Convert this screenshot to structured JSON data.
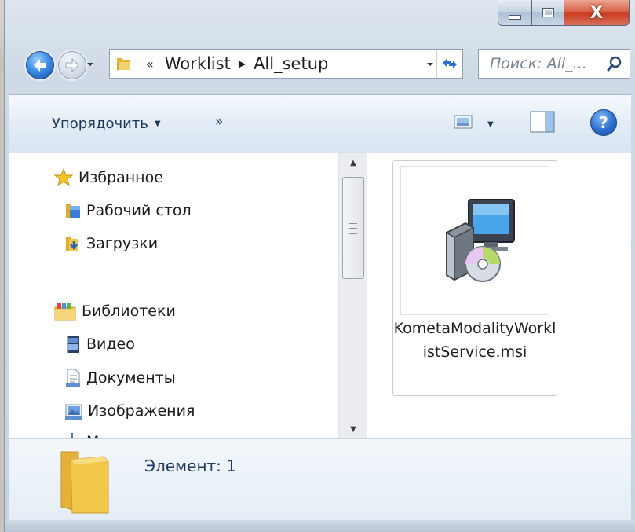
{
  "window": {
    "caption_buttons": {
      "minimize": "minimize",
      "maximize": "maximize",
      "close": "X"
    }
  },
  "navigation": {
    "back": "back",
    "forward": "forward"
  },
  "address_bar": {
    "overflow": "«",
    "crumbs": [
      "Worklist",
      "All_setup"
    ]
  },
  "search": {
    "placeholder": "Поиск: All_..."
  },
  "toolbar": {
    "organize_label": "Упорядочить",
    "more_label": "»",
    "help_label": "?"
  },
  "nav_pane": {
    "favorites": {
      "label": "Избранное",
      "items": [
        "Рабочий стол",
        "Загрузки"
      ]
    },
    "libraries": {
      "label": "Библиотеки",
      "items": [
        "Видео",
        "Документы",
        "Изображения",
        "М"
      ]
    }
  },
  "files": [
    {
      "name": "KometaModalityWorklistService.msi"
    }
  ],
  "details_pane": {
    "text": "Элемент: 1"
  },
  "colors": {
    "accent": "#1e395b",
    "close_button": "#c8391d",
    "folder": "#f2c84b"
  }
}
